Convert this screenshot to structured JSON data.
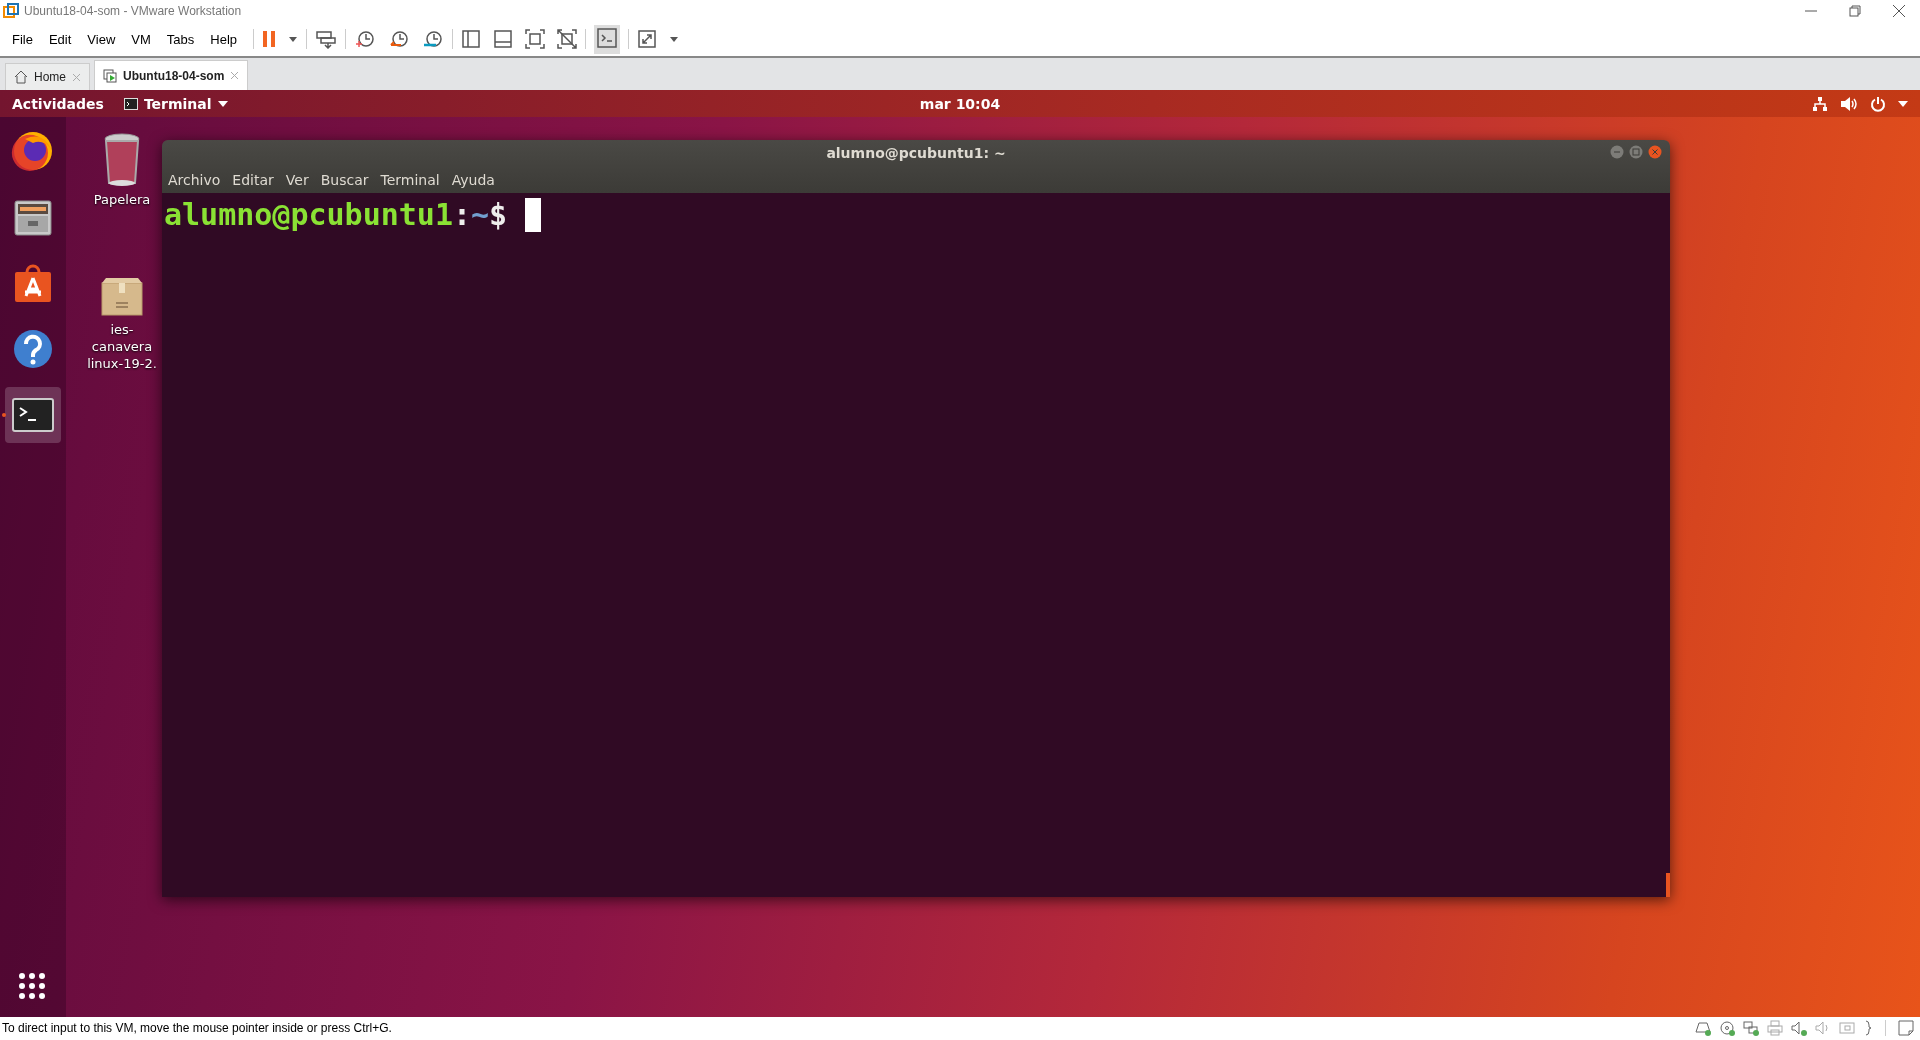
{
  "window": {
    "title": "Ubuntu18-04-som - VMware Workstation"
  },
  "menu": [
    "File",
    "Edit",
    "View",
    "VM",
    "Tabs",
    "Help"
  ],
  "tabs": [
    {
      "label": "Home",
      "kind": "home",
      "selected": false
    },
    {
      "label": "Ubuntu18-04-som",
      "kind": "vm",
      "selected": true
    }
  ],
  "guest": {
    "topbar": {
      "activities": "Actividades",
      "app_menu": "Terminal",
      "clock": "mar 10:04"
    },
    "dock": [
      {
        "kind": "firefox",
        "selected": false
      },
      {
        "kind": "files",
        "selected": false
      },
      {
        "kind": "software",
        "selected": false
      },
      {
        "kind": "help",
        "selected": false
      },
      {
        "kind": "terminal",
        "selected": true
      }
    ],
    "desktop_icons": [
      {
        "kind": "trash",
        "lines": [
          "Papelera"
        ]
      },
      {
        "kind": "zip",
        "lines": [
          "ies-",
          "canavera",
          "linux-19-2."
        ]
      }
    ],
    "terminal": {
      "title": "alumno@pcubuntu1: ~",
      "menu": [
        "Archivo",
        "Editar",
        "Ver",
        "Buscar",
        "Terminal",
        "Ayuda"
      ],
      "prompt": {
        "user_host": "alumno@pcubuntu1",
        "separator": ":",
        "path": "~",
        "symbol": "$"
      }
    }
  },
  "status_bar": {
    "message": "To direct input to this VM, move the mouse pointer inside or press Ctrl+G."
  }
}
